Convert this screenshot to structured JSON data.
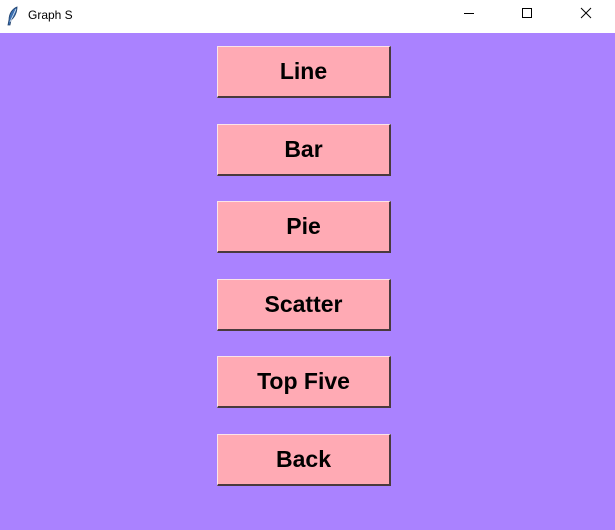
{
  "window": {
    "title": "Graph S"
  },
  "colors": {
    "background": "#aa82ff",
    "button": "#ffaab4"
  },
  "icons": {
    "app": "feather-icon",
    "minimize": "minimize-icon",
    "maximize": "maximize-icon",
    "close": "close-icon"
  },
  "buttons": {
    "line": "Line",
    "bar": "Bar",
    "pie": "Pie",
    "scatter": "Scatter",
    "top_five": "Top Five",
    "back": "Back"
  }
}
